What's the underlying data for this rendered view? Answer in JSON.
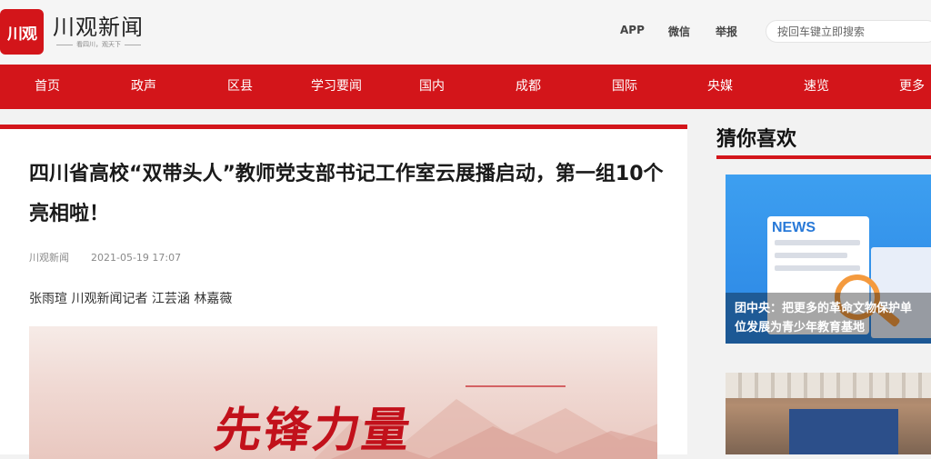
{
  "brand": {
    "logo_mark": "川观",
    "name": "川观新闻",
    "slogan": "看四川，观天下"
  },
  "header": {
    "links": [
      "APP",
      "微信",
      "举报"
    ],
    "search_placeholder": "按回车键立即搜索"
  },
  "nav": {
    "items": [
      "首页",
      "政声",
      "区县",
      "学习要闻",
      "国内",
      "成都",
      "国际",
      "央媒",
      "速览",
      "更多"
    ]
  },
  "article": {
    "title": "四川省高校“双带头人”教师党支部书记工作室云展播启动，第一组10个亮相啦！",
    "source": "川观新闻",
    "date": "2021-05-19 17:07",
    "authors": "张雨瑄 川观新闻记者 江芸涵 林嘉薇",
    "hero_text": "先锋力量"
  },
  "sidebar": {
    "title": "猜你喜欢",
    "cards": [
      {
        "image_word": "NEWS",
        "caption_line1": "团中央：把更多的革命文物保护单",
        "caption_line2": "位发展为青少年教育基地"
      }
    ]
  },
  "colors": {
    "brand_red": "#d3151a",
    "card_blue": "#2b86e4",
    "magnifier_orange": "#f49a3e"
  },
  "icons": [
    "logo-mark-icon",
    "news-illustration",
    "magnifier-icon"
  ]
}
